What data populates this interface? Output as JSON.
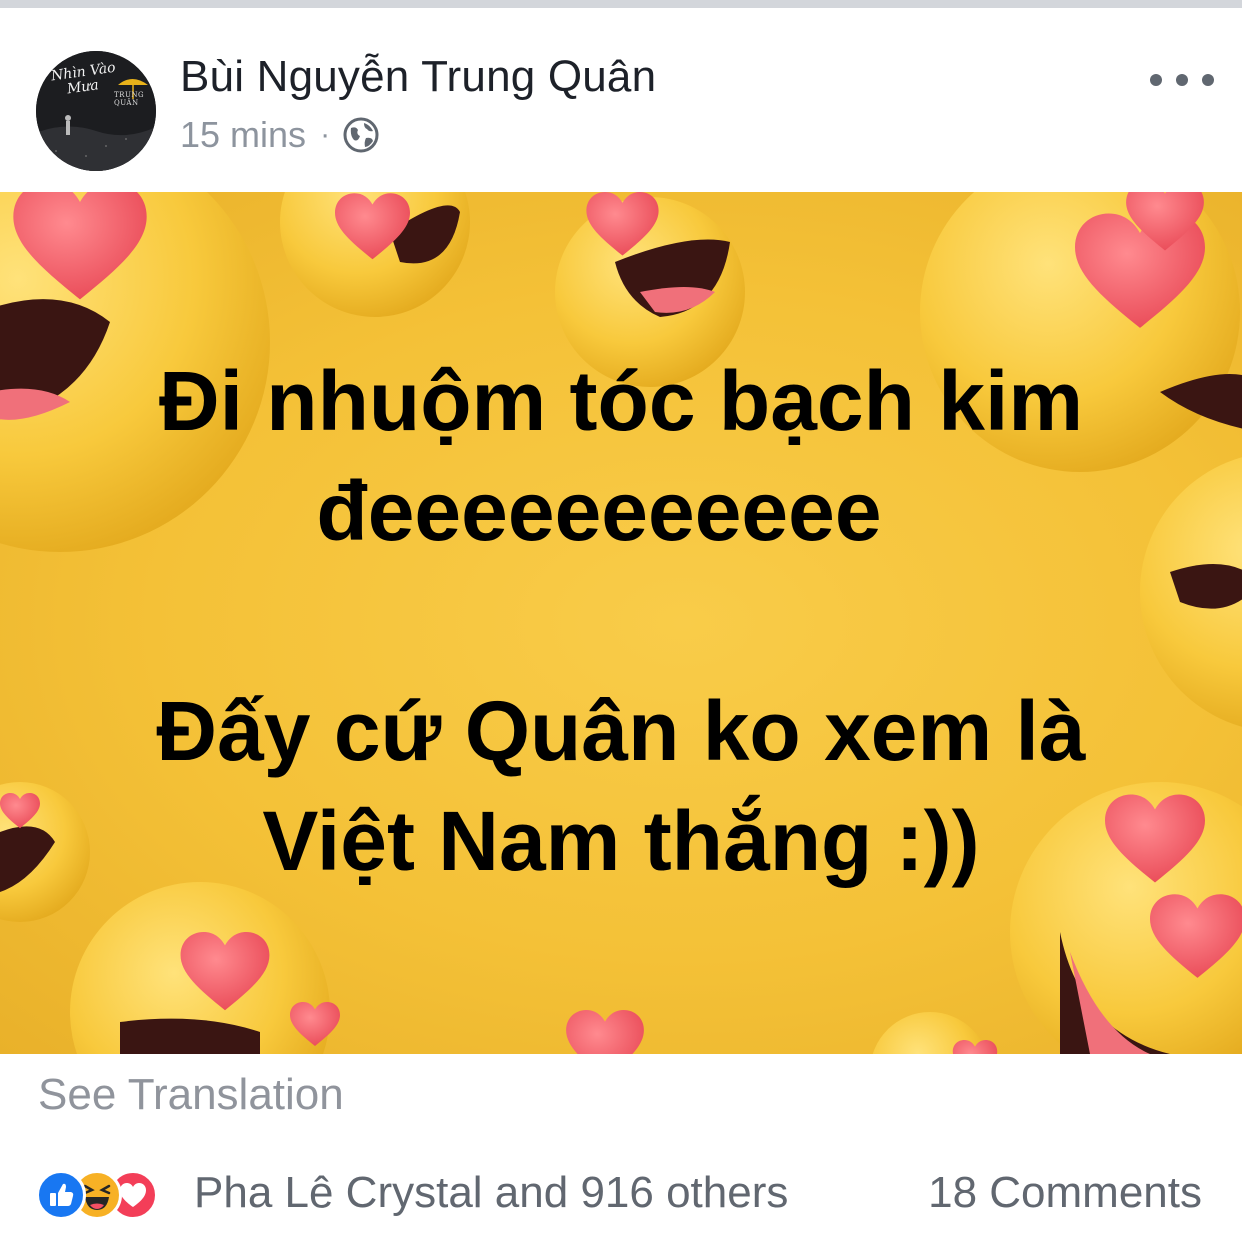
{
  "post": {
    "author": "Bùi Nguyễn Trung Quân",
    "timestamp": "15 mins",
    "separator": "·",
    "privacy_icon": "globe-icon",
    "avatar_lines": [
      "Nhìn Vào",
      "Mưa"
    ],
    "avatar_sub": "TRUNG QUÂN",
    "more_icon": "more-horizontal-icon"
  },
  "image_text": {
    "line1": "Đi nhuộm tóc bạch kim",
    "line2": "đeeeeeeeeeee",
    "line3": "Đấy cứ Quân ko xem là",
    "line4": "Việt Nam thắng :))"
  },
  "see_translation": "See Translation",
  "footer": {
    "reaction_icons": [
      "like-icon",
      "haha-icon",
      "love-icon"
    ],
    "reactors": "Pha Lê Crystal and 916 others",
    "comments": "18 Comments"
  },
  "colors": {
    "background_yellow": "#f4c137",
    "like_blue": "#1877f2",
    "love_red": "#f33e58",
    "haha_yellow": "#f7b125"
  }
}
